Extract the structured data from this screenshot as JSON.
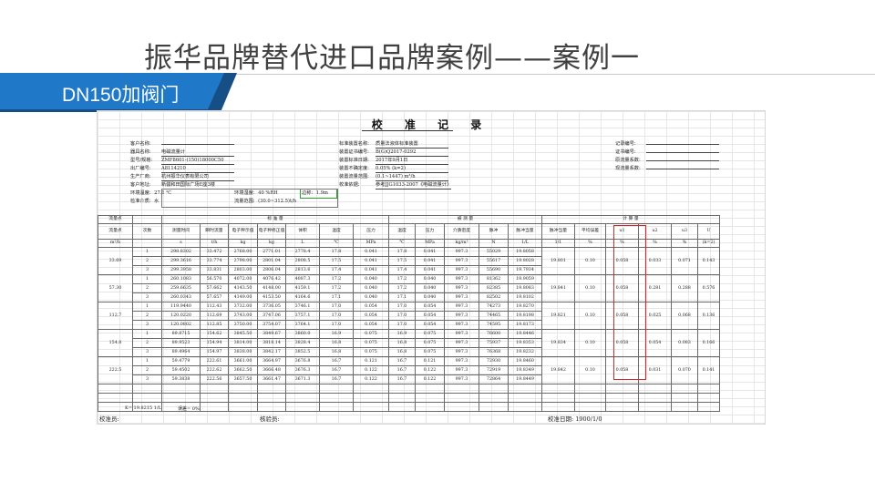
{
  "slide": {
    "title": "振华品牌替代进口品牌案例——案例一",
    "tag": "DN150加阀门",
    "accent": "#1f78c8",
    "accent_dark": "#164f86"
  },
  "sheet": {
    "title": "校 准 记 录",
    "info_left": [
      {
        "label": "客户名称:",
        "value": ""
      },
      {
        "label": "器具名称:",
        "value": "电磁流量计"
      },
      {
        "label": "型号/规格:",
        "value": "ZMF8601-(150)18000C50"
      },
      {
        "label": "出厂编号:",
        "value": "A8114210"
      },
      {
        "label": "生产厂商:",
        "value": "杭州振华仪表有限公司"
      },
      {
        "label": "客户地址:",
        "value": "新疆和田国际广场E座3楼"
      }
    ],
    "env_temp": {
      "label": "环境温度:",
      "value": "27.1 ℃"
    },
    "env_humid": {
      "label": "环境湿度:",
      "value": "40 %RH"
    },
    "pressure": {
      "label": "边称:",
      "value": "1.9m"
    },
    "medium": {
      "label": "检准介质:",
      "value": "水"
    },
    "flow_range": {
      "label": "流量范围:",
      "value": "(30.0~312.5)t/h"
    },
    "info_mid": [
      {
        "label": "标准装置名称:",
        "value": "质量法液体标准装置"
      },
      {
        "label": "装置证书编号:",
        "value": "B(G)Q2017-0292"
      },
      {
        "label": "装置标准日期:",
        "value": "2017年9月1日"
      },
      {
        "label": "装置不确定度:",
        "value": "0.05% (k=2)"
      },
      {
        "label": "装置流量范围:",
        "value": "(0.1~1447) m³/h"
      },
      {
        "label": "校准依据:",
        "value": "参考JJG1033-2007《电磁流量计》"
      }
    ],
    "info_right": [
      {
        "label": "记录编号:",
        "value": ""
      },
      {
        "label": "证书编号:",
        "value": ""
      },
      {
        "label": "原流量系数:",
        "value": ""
      },
      {
        "label": "现流量系数:",
        "value": ""
      }
    ],
    "table": {
      "group_headers": [
        "流量点",
        "标      准      量",
        "被      测      量",
        "计      算      量"
      ],
      "headers1": [
        "流量点",
        "次数",
        "测量时间",
        "瞬时流量",
        "电子秤示值",
        "电子秤修正值",
        "体积",
        "温度",
        "压力",
        "温度",
        "压力",
        "介质密度",
        "脉冲",
        "脉冲当量",
        "脉冲当量",
        "平均误差",
        "u1",
        "u2",
        "u3",
        "U"
      ],
      "units": [
        "m³/h",
        "",
        "s",
        "t/h",
        "kg",
        "kg",
        "L",
        "℃",
        "MPa",
        "℃",
        "MPa",
        "kg/m³",
        "N",
        "1/L",
        "1/1",
        "%",
        "%",
        "%",
        "%",
        "(k=2)"
      ],
      "groups": [
        {
          "point": "33.69",
          "pulse_eq": "19.801",
          "avg_err": "0.10",
          "u1": "0.058",
          "u2": "0.033",
          "u3": "0.071",
          "U": "0.143",
          "rows": [
            [
              "1",
              "298.8302",
              "33.472",
              "2768.00",
              "2771.01",
              "2778.4",
              "17.8",
              "0.041",
              "17.8",
              "0.041",
              "997.3",
              "55029",
              "19.8058"
            ],
            [
              "2",
              "299.3616",
              "33.774",
              "2798.00",
              "2801.04",
              "2808.5",
              "17.5",
              "0.041",
              "17.5",
              "0.041",
              "997.3",
              "55617",
              "19.8028"
            ],
            [
              "3",
              "299.3958",
              "33.831",
              "2803.00",
              "2806.04",
              "2813.6",
              "17.4",
              "0.041",
              "17.4",
              "0.041",
              "997.3",
              "55690",
              "19.7934"
            ]
          ]
        },
        {
          "point": "57.30",
          "pulse_eq": "19.841",
          "avg_err": "0.10",
          "u1": "0.058",
          "u2": "0.281",
          "u3": "0.288",
          "U": "0.576",
          "rows": [
            [
              "1",
              "260.1083",
              "56.570",
              "4072.00",
              "4076.42",
              "4087.3",
              "17.2",
              "0.040",
              "17.2",
              "0.040",
              "997.3",
              "81362",
              "19.9059"
            ],
            [
              "2",
              "259.6635",
              "57.662",
              "4143.50",
              "4148.00",
              "4159.1",
              "17.2",
              "0.040",
              "17.2",
              "0.040",
              "997.3",
              "82385",
              "19.8083"
            ],
            [
              "3",
              "260.0343",
              "57.657",
              "4149.00",
              "4153.50",
              "4164.6",
              "17.1",
              "0.040",
              "17.1",
              "0.040",
              "997.3",
              "82502",
              "19.8102"
            ]
          ]
        },
        {
          "point": "112.7",
          "pulse_eq": "19.821",
          "avg_err": "0.10",
          "u1": "0.058",
          "u2": "0.025",
          "u3": "0.068",
          "U": "0.136",
          "rows": [
            [
              "1",
              "119.9440",
              "112.43",
              "3732.00",
              "3736.05",
              "3746.1",
              "17.0",
              "0.054",
              "17.0",
              "0.054",
              "997.3",
              "74273",
              "19.8270"
            ],
            [
              "2",
              "120.0220",
              "112.69",
              "3743.00",
              "3747.06",
              "3757.1",
              "17.0",
              "0.054",
              "17.0",
              "0.054",
              "997.3",
              "74465",
              "19.8198"
            ],
            [
              "3",
              "120.0802",
              "112.85",
              "3750.00",
              "3754.07",
              "3764.1",
              "17.0",
              "0.054",
              "17.0",
              "0.054",
              "997.3",
              "74595",
              "19.8173"
            ]
          ]
        },
        {
          "point": "154.8",
          "pulse_eq": "19.834",
          "avg_err": "0.10",
          "u1": "0.058",
          "u2": "0.054",
          "u3": "0.083",
          "U": "0.166",
          "rows": [
            [
              "1",
              "89.8715",
              "154.62",
              "3845.50",
              "3849.67",
              "3860.0",
              "16.9",
              "0.075",
              "16.9",
              "0.075",
              "997.3",
              "76600",
              "19.8446"
            ],
            [
              "2",
              "89.9523",
              "154.94",
              "3814.00",
              "3818.14",
              "3828.4",
              "16.8",
              "0.075",
              "16.8",
              "0.075",
              "997.3",
              "75937",
              "19.8353"
            ],
            [
              "3",
              "89.4964",
              "154.97",
              "3838.00",
              "3842.17",
              "3852.5",
              "16.8",
              "0.075",
              "16.8",
              "0.075",
              "997.3",
              "76368",
              "19.8232"
            ]
          ]
        },
        {
          "point": "222.5",
          "pulse_eq": "19.842",
          "avg_err": "0.10",
          "u1": "0.058",
          "u2": "0.031",
          "u3": "0.070",
          "U": "0.141",
          "rows": [
            [
              "1",
              "59.4779",
              "222.61",
              "3661.00",
              "3664.97",
              "3676.8",
              "16.7",
              "0.121",
              "16.7",
              "0.121",
              "997.3",
              "72930",
              "19.8460"
            ],
            [
              "2",
              "59.4502",
              "222.62",
              "3662.50",
              "3666.48",
              "3676.3",
              "16.7",
              "0.122",
              "16.7",
              "0.122",
              "997.3",
              "72919",
              "19.8349"
            ],
            [
              "3",
              "59.3838",
              "222.56",
              "3657.50",
              "3661.47",
              "3671.3",
              "16.7",
              "0.122",
              "16.7",
              "0.122",
              "997.3",
              "72864",
              "19.8449"
            ]
          ]
        }
      ],
      "k_line": "K= 19.8215 1/L",
      "err_line": "误差= 0%"
    },
    "footer": {
      "calibrator": "校准员:",
      "checker": "核验员:",
      "date": "校准日期: 1900/1/0"
    }
  }
}
